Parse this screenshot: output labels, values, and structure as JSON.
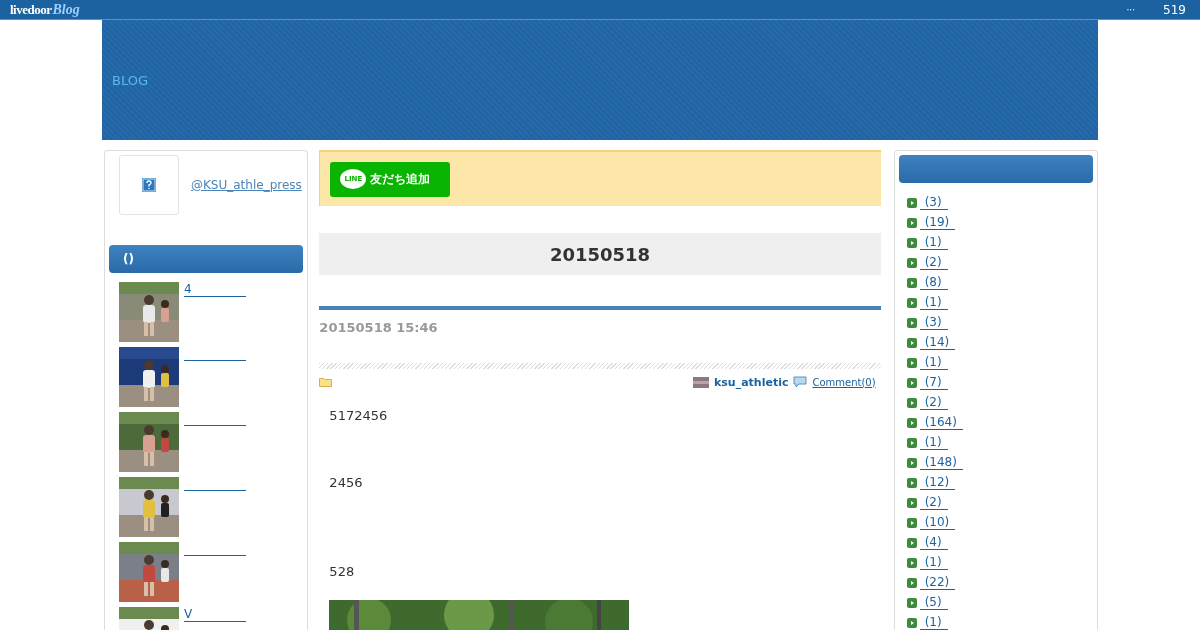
{
  "top_bar": {
    "logo": {
      "word": "livedoor",
      "script": "Blog"
    },
    "menu": "···",
    "count": "519"
  },
  "header": {
    "title": "BLOG"
  },
  "profile": {
    "handle": "@KSU_athle_press"
  },
  "recent_posts": {
    "heading": "()",
    "items": [
      {
        "title": "4",
        "kind": "picture"
      },
      {
        "kind": "picture"
      },
      {
        "kind": "picture"
      },
      {
        "kind": "picture"
      },
      {
        "kind": "picture"
      },
      {
        "title": "V",
        "kind": "picture"
      }
    ]
  },
  "line_button": {
    "badge": "LINE",
    "label": "友だち追加"
  },
  "date_heading": "20150518",
  "article": {
    "timestamp": "20150518 15:46",
    "author": "ksu_athletic",
    "comments": "Comment(0)",
    "paragraphs": [
      "5172456",
      "2456",
      "528"
    ]
  },
  "categories": [
    {
      "label": "(3)"
    },
    {
      "label": "(19)"
    },
    {
      "label": "(1)"
    },
    {
      "label": "(2)"
    },
    {
      "label": "(8)"
    },
    {
      "label": "(1)"
    },
    {
      "label": "(3)"
    },
    {
      "label": "(14)"
    },
    {
      "label": "(1)"
    },
    {
      "label": "(7)"
    },
    {
      "label": "(2)"
    },
    {
      "label": "(164)"
    },
    {
      "label": "(1)"
    },
    {
      "label": "(148)"
    },
    {
      "label": "(12)"
    },
    {
      "label": "(2)"
    },
    {
      "label": "(10)"
    },
    {
      "label": "(4)"
    },
    {
      "label": "(1)"
    },
    {
      "label": "(22)"
    },
    {
      "label": "(5)"
    },
    {
      "label": "(1)"
    }
  ]
}
